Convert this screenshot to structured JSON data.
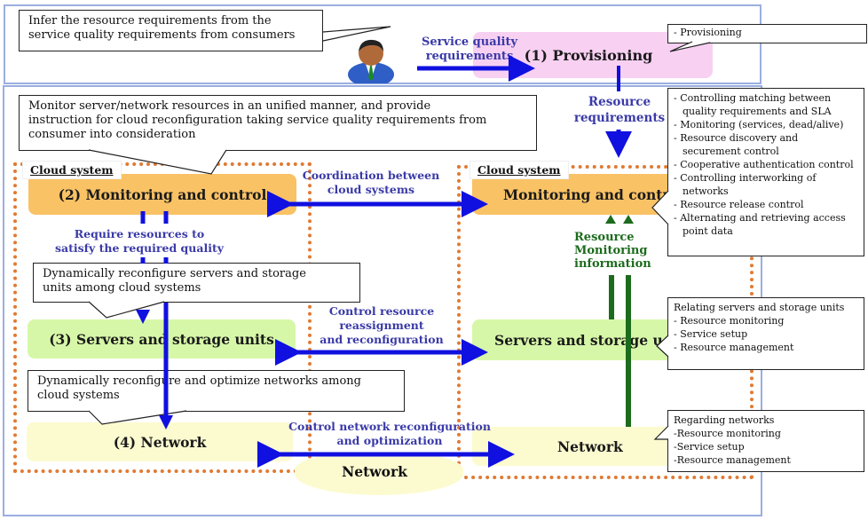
{
  "top_section": {
    "consumer_callout": [
      "Infer the resource requirements from the",
      "service quality requirements from consumers"
    ],
    "service_quality_label": [
      "Service quality",
      "requirements"
    ],
    "provisioning_block": "(1) Provisioning",
    "provisioning_sidebox": [
      "- Provisioning"
    ]
  },
  "resource_requirements_label": [
    "Resource",
    "requirements"
  ],
  "monitoring_callout": [
    "Monitor server/network resources in an unified manner, and provide",
    "instruction for cloud reconfiguration taking service quality requirements from",
    "consumer into consideration"
  ],
  "left_cloud": {
    "label": "Cloud system",
    "monitoring_block": "(2) Monitoring and control",
    "require_label": [
      "Require resources to",
      "satisfy the required quality"
    ],
    "servers_callout": [
      "Dynamically reconfigure servers and storage",
      "units among cloud systems"
    ],
    "servers_block": "(3) Servers and storage units",
    "network_callout": [
      "Dynamically reconfigure and optimize networks among",
      "cloud systems"
    ],
    "network_block": "(4) Network"
  },
  "right_cloud": {
    "label": "Cloud system",
    "monitoring_block": "Monitoring and contr",
    "servers_block": "Servers and storage u",
    "network_block": "Network",
    "resource_monitoring_label": [
      "Resource",
      "Monitoring",
      "information"
    ]
  },
  "middle": {
    "coordination_label": [
      "Coordination between",
      "cloud systems"
    ],
    "control_resource_label": [
      "Control resource",
      "reassignment",
      "and reconfiguration"
    ],
    "control_network_label": [
      "Control network reconfiguration",
      "and optimization"
    ],
    "network_cloud": "Network"
  },
  "monitoring_sidebox": [
    "- Controlling matching between quality requirements and SLA",
    "- Monitoring (services, dead/alive)",
    "- Resource discovery and securement control",
    "- Cooperative authentication control",
    "- Controlling interworking of networks",
    "- Resource release control",
    "- Alternating and retrieving access point data"
  ],
  "servers_sidebox": [
    "Relating servers and storage units",
    "- Resource monitoring",
    "- Service setup",
    "- Resource management"
  ],
  "network_sidebox": [
    "Regarding networks",
    "-Resource monitoring",
    "-Service setup",
    "-Resource management"
  ],
  "colors": {
    "arrow_blue": "#1010e0",
    "label_blue": "#3a3aa8",
    "monitor_green": "#1d6b1d",
    "dotted_orange": "#e07a33",
    "monitoring_block": "#f9c265",
    "servers_block": "#d6f7a8",
    "network_block": "#fcfbd0",
    "provisioning_block": "#f8d0f2"
  }
}
